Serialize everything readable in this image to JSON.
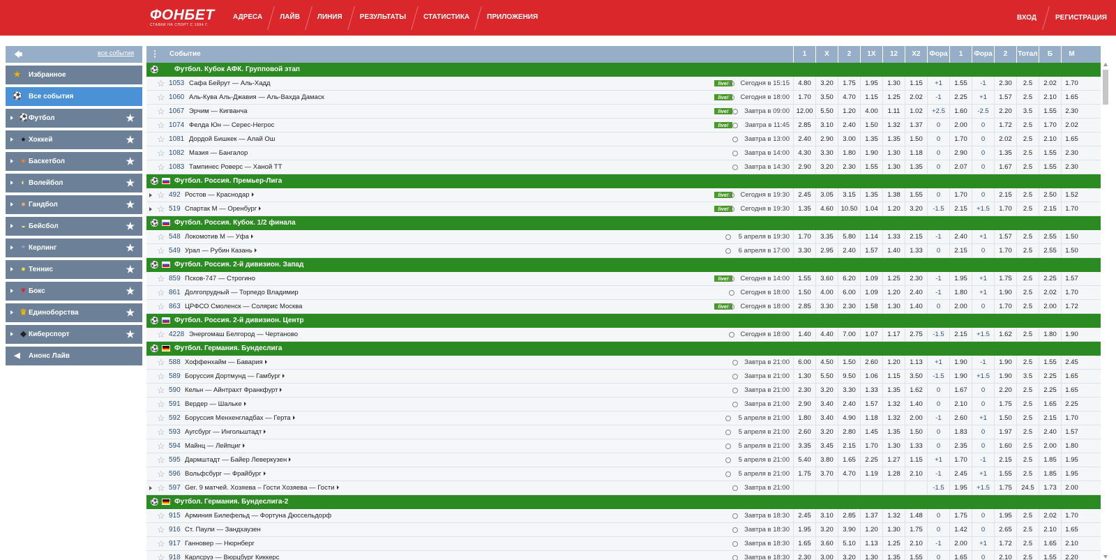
{
  "header": {
    "logo": "ФОНБЕТ",
    "slogan": "СТАВКИ НА СПОРТ С 1994 Г.",
    "nav": [
      "АДРЕСА",
      "ЛАЙВ",
      "ЛИНИЯ",
      "РЕЗУЛЬТАТЫ",
      "СТАТИСТИКА",
      "ПРИЛОЖЕНИЯ"
    ],
    "login": "ВХОД",
    "register": "РЕГИСТРАЦИЯ",
    "bg_color": "#d9272b"
  },
  "sidebar": {
    "back_icon": "back-arrow-icon",
    "all_events_link": "все события",
    "items": [
      {
        "label": "Избранное",
        "icon": "star-icon",
        "glyph": "★",
        "color": "#f0b400",
        "arrow": false,
        "star": false,
        "active": false
      },
      {
        "label": "Все события",
        "icon": "soccer-ball-icon",
        "glyph": "⚽",
        "color": "#fff",
        "arrow": false,
        "star": false,
        "active": true
      },
      {
        "label": "Футбол",
        "icon": "football-icon",
        "glyph": "⚽",
        "color": "#fff",
        "arrow": true,
        "star": true,
        "active": false
      },
      {
        "label": "Хоккей",
        "icon": "hockey-puck-icon",
        "glyph": "●",
        "color": "#222",
        "arrow": true,
        "star": true,
        "active": false
      },
      {
        "label": "Баскетбол",
        "icon": "basketball-icon",
        "glyph": "●",
        "color": "#e8852a",
        "arrow": true,
        "star": true,
        "active": false
      },
      {
        "label": "Волейбол",
        "icon": "volleyball-icon",
        "glyph": "◐",
        "color": "#f3e27a",
        "arrow": true,
        "star": true,
        "active": false
      },
      {
        "label": "Гандбол",
        "icon": "handball-icon",
        "glyph": "●",
        "color": "#f1a860",
        "arrow": true,
        "star": true,
        "active": false
      },
      {
        "label": "Бейсбол",
        "icon": "baseball-icon",
        "glyph": "◒",
        "color": "#f3e27a",
        "arrow": true,
        "star": true,
        "active": false
      },
      {
        "label": "Керлинг",
        "icon": "curling-icon",
        "glyph": "◓",
        "color": "#8fb1d6",
        "arrow": true,
        "star": true,
        "active": false
      },
      {
        "label": "Теннис",
        "icon": "tennis-ball-icon",
        "glyph": "●",
        "color": "#e6e03a",
        "arrow": true,
        "star": true,
        "active": false
      },
      {
        "label": "Бокс",
        "icon": "boxing-glove-icon",
        "glyph": "▼",
        "color": "#d9272b",
        "arrow": true,
        "star": true,
        "active": false
      },
      {
        "label": "Единоборства",
        "icon": "trophy-icon",
        "glyph": "♛",
        "color": "#f0b400",
        "arrow": true,
        "star": true,
        "active": false
      },
      {
        "label": "Киберспорт",
        "icon": "gamepad-icon",
        "glyph": "◆",
        "color": "#222",
        "arrow": true,
        "star": true,
        "active": false
      },
      {
        "label": "Анонс Лайв",
        "icon": "megaphone-icon",
        "glyph": "◀",
        "color": "#fff",
        "arrow": false,
        "star": false,
        "active": false
      }
    ]
  },
  "table": {
    "event_header": "Событие",
    "columns": [
      "1",
      "X",
      "2",
      "1X",
      "12",
      "X2",
      "Фора",
      "1",
      "Фора",
      "2",
      "Тотал",
      "Б",
      "М"
    ],
    "group_color": "#2b8a22",
    "live_label": "live!",
    "rows": [
      {
        "type": "group",
        "flag": "",
        "title": "Футбол. Кубок АФК. Групповой этап"
      },
      {
        "type": "event",
        "num": "1053",
        "title": "Сафа Бейрут — Аль-Хадд",
        "live": true,
        "expand": false,
        "more": false,
        "time": "Сегодня в 15:15",
        "odds": [
          "4.80",
          "3.20",
          "1.75",
          "1.95",
          "1.30",
          "1.15",
          "+1",
          "1.55",
          "-1",
          "2.30",
          "2.5",
          "2.02",
          "1.70"
        ]
      },
      {
        "type": "event",
        "num": "1060",
        "title": "Аль-Кува Аль-Джавия — Аль-Вахда Дамаск",
        "live": true,
        "expand": false,
        "more": false,
        "time": "Сегодня в 18:00",
        "odds": [
          "1.70",
          "3.50",
          "4.70",
          "1.15",
          "1.25",
          "2.02",
          "-1",
          "2.25",
          "+1",
          "1.57",
          "2.5",
          "2.10",
          "1.65"
        ]
      },
      {
        "type": "event",
        "num": "1067",
        "title": "Эрчим — Кигванча",
        "live": true,
        "expand": false,
        "more": false,
        "time": "Завтра в 09:00",
        "odds": [
          "12.00",
          "5.50",
          "1.20",
          "4.00",
          "1.11",
          "1.02",
          "+2.5",
          "1.60",
          "-2.5",
          "2.20",
          "3.5",
          "1.55",
          "2.30"
        ]
      },
      {
        "type": "event",
        "num": "1074",
        "title": "Фелда Юн — Серес-Негрос",
        "live": true,
        "expand": false,
        "more": false,
        "time": "Завтра в 11:45",
        "odds": [
          "2.85",
          "3.10",
          "2.40",
          "1.50",
          "1.32",
          "1.37",
          "0",
          "2.00",
          "0",
          "1.72",
          "2.5",
          "1.70",
          "2.02"
        ]
      },
      {
        "type": "event",
        "num": "1081",
        "title": "Дордой Бишкек — Алай Ош",
        "live": false,
        "expand": false,
        "more": false,
        "time": "Завтра в 13:00",
        "odds": [
          "2.40",
          "2.90",
          "3.00",
          "1.35",
          "1.35",
          "1.50",
          "0",
          "1.70",
          "0",
          "2.02",
          "2.5",
          "2.10",
          "1.65"
        ]
      },
      {
        "type": "event",
        "num": "1082",
        "title": "Мазия — Бангалор",
        "live": false,
        "expand": false,
        "more": false,
        "time": "Завтра в 14:00",
        "odds": [
          "4.30",
          "3.30",
          "1.80",
          "1.90",
          "1.30",
          "1.18",
          "0",
          "2.90",
          "0",
          "1.35",
          "2.5",
          "1.55",
          "2.30"
        ]
      },
      {
        "type": "event",
        "num": "1083",
        "title": "Тампинес Роверс — Ханой ТТ",
        "live": false,
        "expand": false,
        "more": false,
        "time": "Завтра в 14:30",
        "odds": [
          "2.90",
          "3.20",
          "2.30",
          "1.55",
          "1.30",
          "1.35",
          "0",
          "2.07",
          "0",
          "1.67",
          "2.5",
          "1.55",
          "2.30"
        ]
      },
      {
        "type": "group",
        "flag": "ru",
        "title": "Футбол. Россия. Премьер-Лига"
      },
      {
        "type": "event",
        "num": "492",
        "title": "Ростов — Краснодар",
        "live": true,
        "expand": true,
        "more": true,
        "time": "Сегодня в 19:30",
        "odds": [
          "2.45",
          "3.05",
          "3.15",
          "1.35",
          "1.38",
          "1.55",
          "0",
          "1.70",
          "0",
          "2.15",
          "2.5",
          "2.50",
          "1.52"
        ]
      },
      {
        "type": "event",
        "num": "519",
        "title": "Спартак М — Оренбург",
        "live": true,
        "expand": true,
        "more": true,
        "time": "Сегодня в 19:30",
        "odds": [
          "1.35",
          "4.60",
          "10.50",
          "1.04",
          "1.20",
          "3.20",
          "-1.5",
          "2.15",
          "+1.5",
          "1.70",
          "2.5",
          "2.15",
          "1.70"
        ]
      },
      {
        "type": "group",
        "flag": "ru",
        "title": "Футбол. Россия. Кубок. 1/2 финала"
      },
      {
        "type": "event",
        "num": "548",
        "title": "Локомотив М — Уфа",
        "live": false,
        "expand": false,
        "more": true,
        "time": "5 апреля в 19:30",
        "odds": [
          "1.70",
          "3.35",
          "5.80",
          "1.14",
          "1.33",
          "2.15",
          "-1",
          "2.40",
          "+1",
          "1.57",
          "2.5",
          "2.55",
          "1.50"
        ]
      },
      {
        "type": "event",
        "num": "549",
        "title": "Урал — Рубин Казань",
        "live": false,
        "expand": false,
        "more": true,
        "time": "6 апреля в 17:00",
        "odds": [
          "3.30",
          "2.95",
          "2.40",
          "1.57",
          "1.40",
          "1.33",
          "0",
          "2.15",
          "0",
          "1.70",
          "2.5",
          "2.55",
          "1.50"
        ]
      },
      {
        "type": "group",
        "flag": "ru",
        "title": "Футбол. Россия. 2-й дивизион. Запад"
      },
      {
        "type": "event",
        "num": "859",
        "title": "Псков-747 — Строгино",
        "live": true,
        "expand": false,
        "more": false,
        "time": "Сегодня в 14:00",
        "odds": [
          "1.55",
          "3.60",
          "6.20",
          "1.09",
          "1.25",
          "2.30",
          "-1",
          "1.95",
          "+1",
          "1.75",
          "2.5",
          "2.25",
          "1.57"
        ]
      },
      {
        "type": "event",
        "num": "861",
        "title": "Долгопрудный — Торпедо Владимир",
        "live": false,
        "expand": false,
        "more": false,
        "time": "Сегодня в 18:00",
        "odds": [
          "1.50",
          "4.00",
          "6.00",
          "1.09",
          "1.20",
          "2.40",
          "-1",
          "1.80",
          "+1",
          "1.90",
          "2.5",
          "2.02",
          "1.70"
        ]
      },
      {
        "type": "event",
        "num": "863",
        "title": "ЦРФСО Смоленск — Солярис Москва",
        "live": true,
        "expand": false,
        "more": false,
        "time": "Сегодня в 18:00",
        "odds": [
          "2.85",
          "3.30",
          "2.30",
          "1.58",
          "1.30",
          "1.40",
          "0",
          "2.00",
          "0",
          "1.70",
          "2.5",
          "2.00",
          "1.72"
        ]
      },
      {
        "type": "group",
        "flag": "ru",
        "title": "Футбол. Россия. 2-й дивизион. Центр"
      },
      {
        "type": "event",
        "num": "4228",
        "title": "Энергомаш Белгород — Чертаново",
        "live": false,
        "expand": false,
        "more": false,
        "time": "Сегодня в 18:00",
        "odds": [
          "1.40",
          "4.40",
          "7.00",
          "1.07",
          "1.17",
          "2.75",
          "-1.5",
          "2.15",
          "+1.5",
          "1.62",
          "2.5",
          "1.80",
          "1.90"
        ]
      },
      {
        "type": "group",
        "flag": "de",
        "title": "Футбол. Германия. Бундеслига"
      },
      {
        "type": "event",
        "num": "588",
        "title": "Хоффенхайм — Бавария",
        "live": false,
        "expand": false,
        "more": true,
        "time": "Завтра в 21:00",
        "odds": [
          "6.00",
          "4.50",
          "1.50",
          "2.60",
          "1.20",
          "1.13",
          "+1",
          "1.90",
          "-1",
          "1.90",
          "2.5",
          "1.55",
          "2.45"
        ]
      },
      {
        "type": "event",
        "num": "589",
        "title": "Боруссия Дортмунд — Гамбург",
        "live": false,
        "expand": false,
        "more": true,
        "time": "Завтра в 21:00",
        "odds": [
          "1.30",
          "5.50",
          "9.50",
          "1.06",
          "1.15",
          "3.50",
          "-1.5",
          "1.90",
          "+1.5",
          "1.90",
          "3.5",
          "2.25",
          "1.65"
        ]
      },
      {
        "type": "event",
        "num": "590",
        "title": "Кельн — Айнтрахт Франкфурт",
        "live": false,
        "expand": false,
        "more": true,
        "time": "Завтра в 21:00",
        "odds": [
          "2.30",
          "3.20",
          "3.30",
          "1.33",
          "1.35",
          "1.62",
          "0",
          "1.67",
          "0",
          "2.20",
          "2.5",
          "2.25",
          "1.65"
        ]
      },
      {
        "type": "event",
        "num": "591",
        "title": "Вердер — Шальке",
        "live": false,
        "expand": false,
        "more": true,
        "time": "Завтра в 21:00",
        "odds": [
          "2.90",
          "3.40",
          "2.40",
          "1.57",
          "1.32",
          "1.40",
          "0",
          "2.10",
          "0",
          "1.75",
          "2.5",
          "1.65",
          "2.25"
        ]
      },
      {
        "type": "event",
        "num": "592",
        "title": "Боруссия Менхенгладбах — Герта",
        "live": false,
        "expand": false,
        "more": true,
        "time": "5 апреля в 21:00",
        "odds": [
          "1.80",
          "3.40",
          "4.90",
          "1.18",
          "1.32",
          "2.00",
          "-1",
          "2.60",
          "+1",
          "1.50",
          "2.5",
          "2.15",
          "1.70"
        ]
      },
      {
        "type": "event",
        "num": "593",
        "title": "Аугсбург — Ингольштадт",
        "live": false,
        "expand": false,
        "more": true,
        "time": "5 апреля в 21:00",
        "odds": [
          "2.60",
          "3.20",
          "2.80",
          "1.45",
          "1.35",
          "1.50",
          "0",
          "1.83",
          "0",
          "1.97",
          "2.5",
          "2.40",
          "1.57"
        ]
      },
      {
        "type": "event",
        "num": "594",
        "title": "Майнц — Лейпциг",
        "live": false,
        "expand": false,
        "more": true,
        "time": "5 апреля в 21:00",
        "odds": [
          "3.35",
          "3.45",
          "2.15",
          "1.70",
          "1.30",
          "1.33",
          "0",
          "2.35",
          "0",
          "1.60",
          "2.5",
          "2.00",
          "1.80"
        ]
      },
      {
        "type": "event",
        "num": "595",
        "title": "Дармштадт — Байер Леверкузен",
        "live": false,
        "expand": false,
        "more": true,
        "time": "5 апреля в 21:00",
        "odds": [
          "5.40",
          "3.80",
          "1.65",
          "2.25",
          "1.27",
          "1.15",
          "+1",
          "1.70",
          "-1",
          "2.15",
          "2.5",
          "1.85",
          "1.95"
        ]
      },
      {
        "type": "event",
        "num": "596",
        "title": "Вольфсбург — Фрайбург",
        "live": false,
        "expand": false,
        "more": true,
        "time": "5 апреля в 21:00",
        "odds": [
          "1.75",
          "3.70",
          "4.70",
          "1.19",
          "1.28",
          "2.10",
          "-1",
          "2.45",
          "+1",
          "1.55",
          "2.5",
          "1.85",
          "1.95"
        ]
      },
      {
        "type": "event",
        "num": "597",
        "title": "Ger. 9 матчей. Хозяева – Гости Хозяева — Гости",
        "live": false,
        "expand": true,
        "more": true,
        "time": "Завтра в 21:00",
        "odds": [
          "",
          "",
          "",
          "",
          "",
          "",
          "-1.5",
          "1.95",
          "+1.5",
          "1.75",
          "24.5",
          "1.73",
          "2.00"
        ]
      },
      {
        "type": "group",
        "flag": "de",
        "title": "Футбол. Германия. Бундеслига-2"
      },
      {
        "type": "event",
        "num": "915",
        "title": "Арминия Билефельд — Фортуна Дюссельдорф",
        "live": false,
        "expand": false,
        "more": false,
        "time": "Завтра в 18:30",
        "odds": [
          "2.45",
          "3.10",
          "2.85",
          "1.37",
          "1.32",
          "1.48",
          "0",
          "1.75",
          "0",
          "1.95",
          "2.5",
          "2.02",
          "1.70"
        ]
      },
      {
        "type": "event",
        "num": "916",
        "title": "Ст. Паули — Зандхаузен",
        "live": false,
        "expand": false,
        "more": false,
        "time": "Завтра в 18:30",
        "odds": [
          "1.95",
          "3.20",
          "3.90",
          "1.20",
          "1.30",
          "1.75",
          "0",
          "1.42",
          "0",
          "2.65",
          "2.5",
          "2.10",
          "1.65"
        ]
      },
      {
        "type": "event",
        "num": "917",
        "title": "Ганновер — Нюрнберг",
        "live": false,
        "expand": false,
        "more": false,
        "time": "Завтра в 18:30",
        "odds": [
          "1.65",
          "3.60",
          "5.10",
          "1.13",
          "1.25",
          "2.10",
          "-1",
          "2.00",
          "+1",
          "1.72",
          "2.5",
          "1.65",
          "2.10"
        ]
      },
      {
        "type": "event",
        "num": "918",
        "title": "Карлсруэ — Вюрцбург Киккерс",
        "live": false,
        "expand": false,
        "more": false,
        "time": "Завтра в 18:30",
        "odds": [
          "2.30",
          "3.00",
          "3.20",
          "1.30",
          "1.35",
          "1.55",
          "0",
          "1.65",
          "0",
          "2.10",
          "2.5",
          "1.55",
          "2.20"
        ]
      }
    ]
  }
}
